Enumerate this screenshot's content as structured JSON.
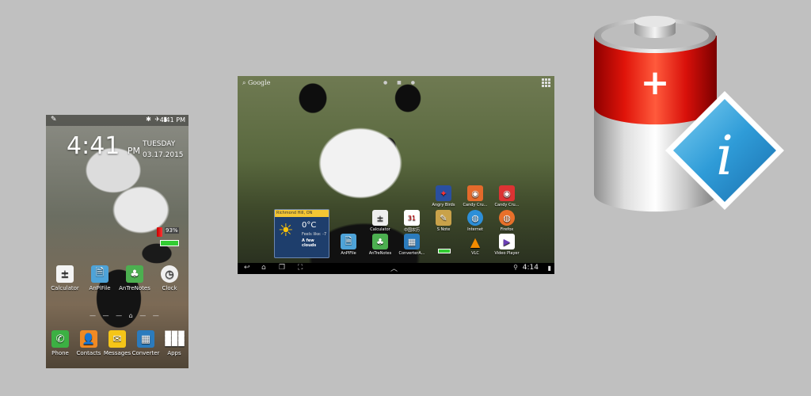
{
  "phone": {
    "status_time": "4:41 PM",
    "clock": "4:41",
    "clock_ampm": "PM",
    "day": "TUESDAY",
    "date": "03.17.2015",
    "battery_widget_pct": "93%",
    "row1": [
      {
        "label": "Calculator",
        "icon": "calculator-icon",
        "color": "#f4f4f4",
        "glyph": "±"
      },
      {
        "label": "AnPlFile",
        "icon": "anplfile-icon",
        "color": "#4ea3d8",
        "glyph": "🗎"
      },
      {
        "label": "AnTreNotes",
        "icon": "antrenotes-icon",
        "color": "#4caf50",
        "glyph": "♣"
      },
      {
        "label": "Clock",
        "icon": "clock-icon",
        "color": "#f0f0f0",
        "glyph": "◷"
      }
    ],
    "row2": [
      {
        "label": "Phone",
        "icon": "phone-icon",
        "color": "#3cb043",
        "glyph": "✆"
      },
      {
        "label": "Contacts",
        "icon": "contacts-icon",
        "color": "#f08a24",
        "glyph": "👤"
      },
      {
        "label": "Messages",
        "icon": "messages-icon",
        "color": "#f5c518",
        "glyph": "✉"
      },
      {
        "label": "Converter",
        "icon": "converter-icon",
        "color": "#2b7bbd",
        "glyph": "▦"
      },
      {
        "label": "Apps",
        "icon": "apps-grid-icon",
        "color": "transparent",
        "glyph": "⋮⋮⋮"
      }
    ]
  },
  "tablet": {
    "search_label": "Google",
    "weather": {
      "location": "Richmond Hill, ON",
      "temp": "0°C",
      "feels": "Feels like: -7",
      "condition": "A few clouds"
    },
    "apps": [
      {
        "label": "Angry Birds",
        "icon": "angry-birds-icon",
        "color": "#2a4fa0",
        "glyph": "✦"
      },
      {
        "label": "Candy Cru...",
        "icon": "candy-crush-icon",
        "color": "#e46a2b",
        "glyph": "◉"
      },
      {
        "label": "Candy Cru...",
        "icon": "candy-crush-soda-icon",
        "color": "#d33",
        "glyph": "◉"
      },
      {
        "label": "Calculator",
        "icon": "calculator-icon",
        "color": "#eee",
        "glyph": "±"
      },
      {
        "label": "中国农历",
        "icon": "calendar-icon",
        "color": "#fff",
        "glyph": "31"
      },
      {
        "label": "S Note",
        "icon": "s-note-icon",
        "color": "#c9a24a",
        "glyph": "✎"
      },
      {
        "label": "Internet",
        "icon": "internet-icon",
        "color": "#2d8fd8",
        "glyph": "🌐"
      },
      {
        "label": "Firefox",
        "icon": "firefox-icon",
        "color": "#e8702a",
        "glyph": "◍"
      },
      {
        "label": "AnPlFile",
        "icon": "anplfile-icon",
        "color": "#4ea3d8",
        "glyph": "🗎"
      },
      {
        "label": "AnTreNotes",
        "icon": "antrenotes-icon",
        "color": "#4caf50",
        "glyph": "♣"
      },
      {
        "label": "ConverterA...",
        "icon": "converter-icon",
        "color": "#2b7bbd",
        "glyph": "▦"
      },
      {
        "label": "VLC",
        "icon": "vlc-icon",
        "color": "transparent",
        "glyph": "▲"
      },
      {
        "label": "Video Player",
        "icon": "video-player-icon",
        "color": "#fff",
        "glyph": "▶"
      }
    ],
    "time": "4:14"
  },
  "logo": {
    "plus_symbol": "+",
    "info_letter": "i"
  }
}
